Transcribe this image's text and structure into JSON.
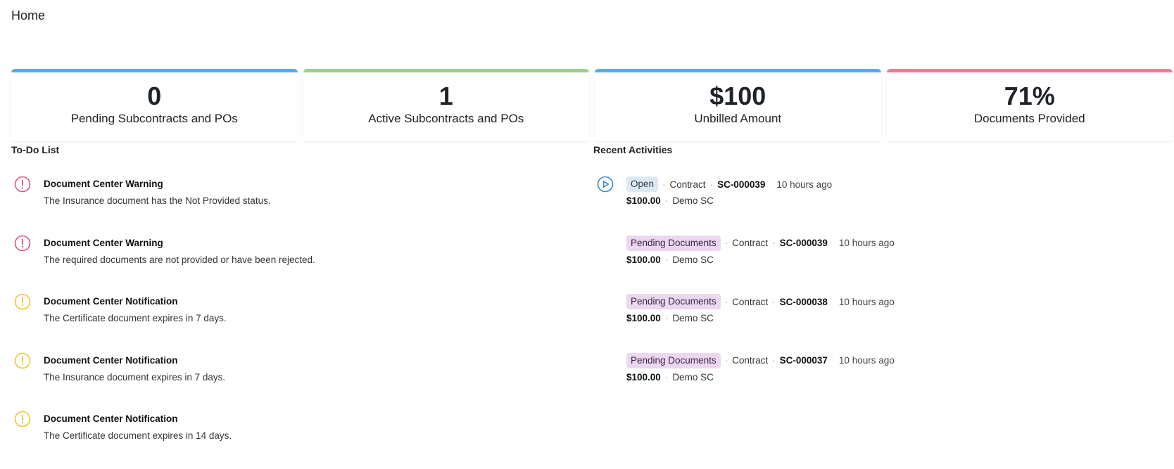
{
  "header": {
    "title": "Home"
  },
  "cards": [
    {
      "value": "0",
      "label": "Pending Subcontracts and POs",
      "color": "#5aa9e6"
    },
    {
      "value": "1",
      "label": "Active Subcontracts and POs",
      "color": "#9bd18a"
    },
    {
      "value": "$100",
      "label": "Unbilled Amount",
      "color": "#5aa9e6"
    },
    {
      "value": "71%",
      "label": "Documents Provided",
      "color": "#e8808f"
    }
  ],
  "todo": {
    "title": "To-Do List",
    "items": [
      {
        "icon": "warning-circle-icon",
        "severity": "warning",
        "color": "#e0557a",
        "title": "Document Center Warning",
        "description": "The Insurance document has the Not Provided status."
      },
      {
        "icon": "warning-circle-icon",
        "severity": "warning",
        "color": "#e0557a",
        "title": "Document Center Warning",
        "description": "The required documents are not provided or have been rejected."
      },
      {
        "icon": "notification-circle-icon",
        "severity": "notification",
        "color": "#f2c230",
        "title": "Document Center Notification",
        "description": "The Certificate document expires in 7 days."
      },
      {
        "icon": "notification-circle-icon",
        "severity": "notification",
        "color": "#f2c230",
        "title": "Document Center Notification",
        "description": "The Insurance document expires in 7 days."
      },
      {
        "icon": "notification-circle-icon",
        "severity": "notification",
        "color": "#f2c230",
        "title": "Document Center Notification",
        "description": "The Certificate document expires in 14 days."
      }
    ]
  },
  "activities": {
    "title": "Recent Activities",
    "items": [
      {
        "icon": "play-circle-icon",
        "status": "Open",
        "status_type": "open",
        "type": "Contract",
        "number": "SC-000039",
        "time": "10 hours ago",
        "amount": "$100.00",
        "vendor": "Demo SC"
      },
      {
        "icon": "",
        "status": "Pending Documents",
        "status_type": "pending",
        "type": "Contract",
        "number": "SC-000039",
        "time": "10 hours ago",
        "amount": "$100.00",
        "vendor": "Demo SC"
      },
      {
        "icon": "",
        "status": "Pending Documents",
        "status_type": "pending",
        "type": "Contract",
        "number": "SC-000038",
        "time": "10 hours ago",
        "amount": "$100.00",
        "vendor": "Demo SC"
      },
      {
        "icon": "",
        "status": "Pending Documents",
        "status_type": "pending",
        "type": "Contract",
        "number": "SC-000037",
        "time": "10 hours ago",
        "amount": "$100.00",
        "vendor": "Demo SC"
      }
    ]
  },
  "colors": {
    "play_icon": "#3a86d6"
  }
}
